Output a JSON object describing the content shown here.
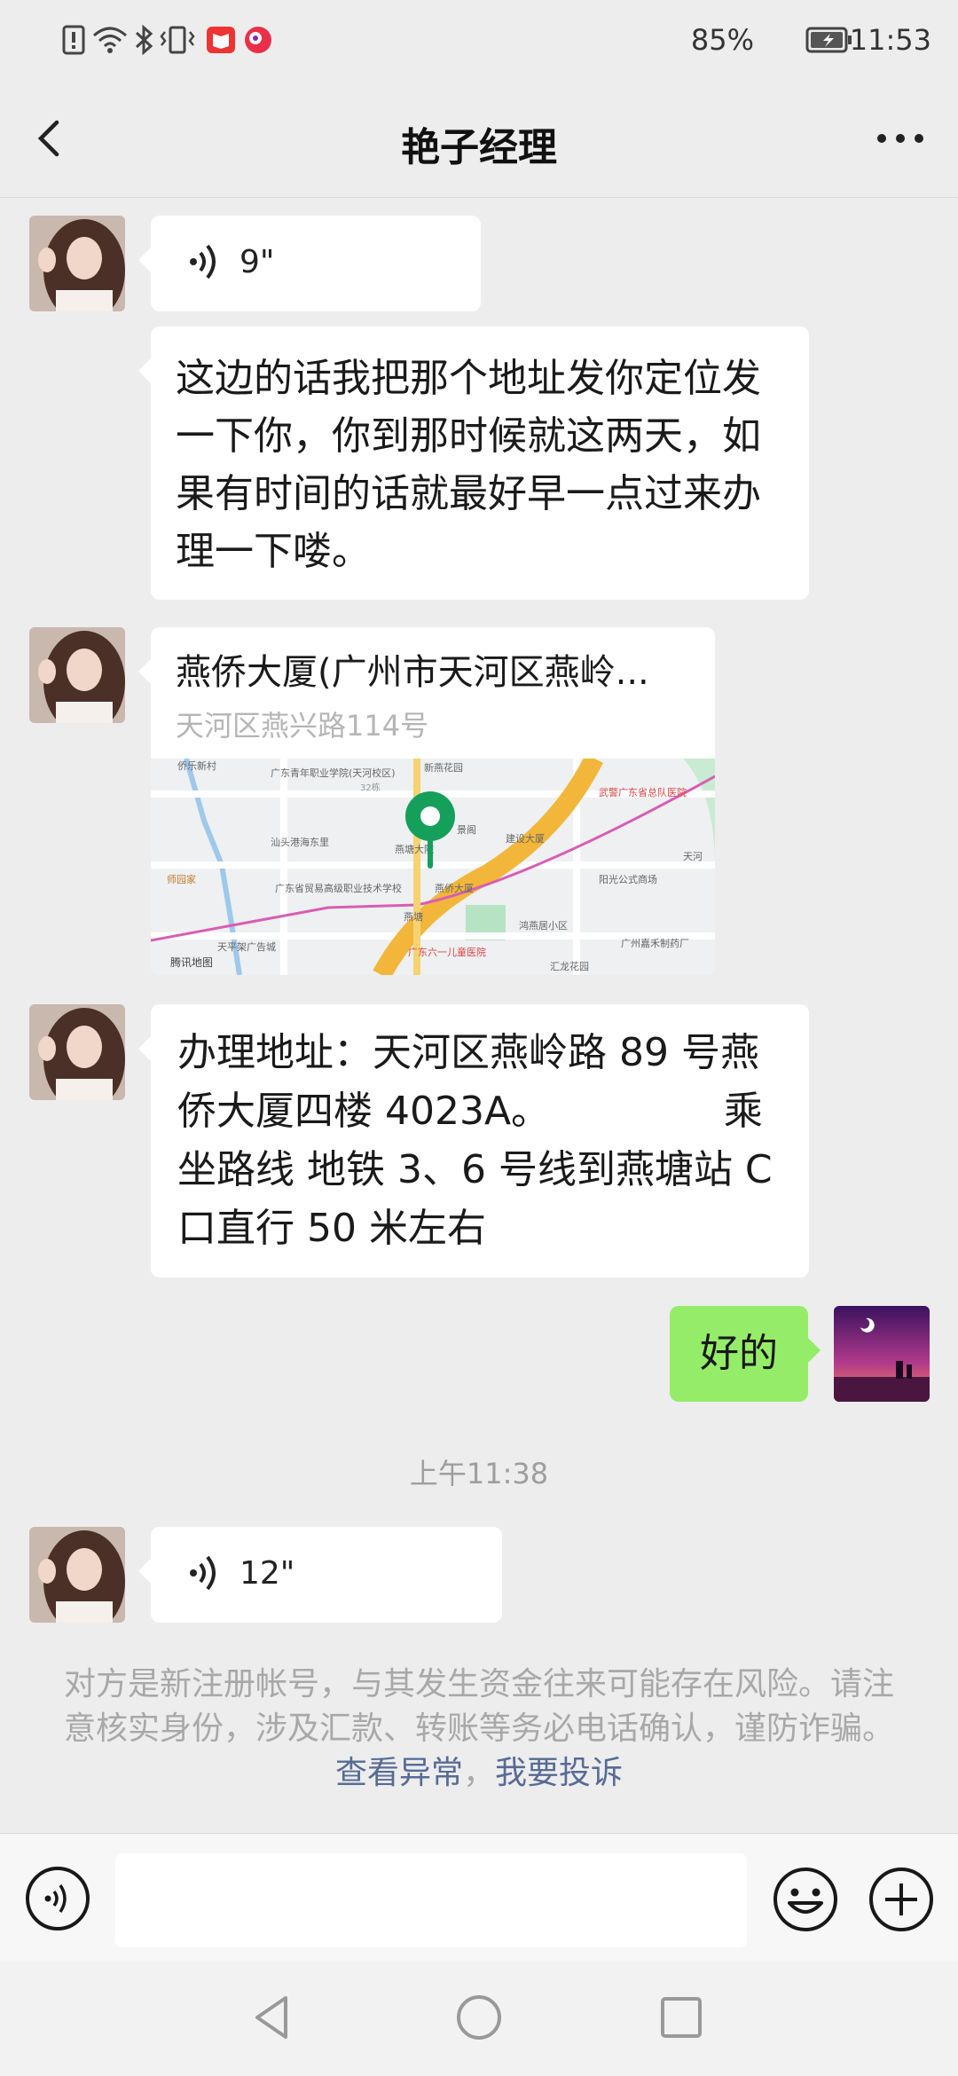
{
  "status_bar": {
    "battery_percent": "85%",
    "time": "11:53",
    "icons": [
      "alert-icon",
      "wifi-icon",
      "bluetooth-icon",
      "vibrate-icon",
      "app-notification-icon",
      "app-notification-icon-2",
      "battery-icon"
    ]
  },
  "header": {
    "title": "艳子经理",
    "back_icon": "chevron-left-icon",
    "more_icon": "more-dots-icon"
  },
  "messages": {
    "voice1_duration": "9\"",
    "text1": "这边的话我把那个地址发你定位发一下你，你到那时候就这两天，如果有时间的话就最好早一点过来办理一下喽。",
    "location": {
      "title": "燕侨大厦(广州市天河区燕岭...",
      "address": "天河区燕兴路114号",
      "map_labels": {
        "l1": "侨乐新村",
        "l2": "广东青年职业学院(天河校区)",
        "l3": "新燕花园",
        "l4": "武警广东省总队医院",
        "l5": "汕头港海东里",
        "l6": "景阁",
        "l7": "建设大厦",
        "l8": "燕塘大院",
        "l9": "天河",
        "l10": "师园家",
        "l11": "广东省贸易高级职业技术学校",
        "l12": "燕侨大厦",
        "l13": "阳光公式商场",
        "l14": "燕塘",
        "l15": "鸿燕居小区",
        "l16": "广州嘉禾制药厂",
        "l17": "天平架广告城",
        "l18": "广东六一儿童医院",
        "l19": "汇龙花园",
        "l20": "腾讯地图",
        "l21": "32栋"
      }
    },
    "text2": "办理地址：天河区燕岭路 89 号燕侨大厦四楼 4023A。              乘坐路线 地铁 3、6 号线到燕塘站 C 口直行 50 米左右",
    "my_reply": "好的",
    "time_separator": "上午11:38",
    "voice2_duration": "12\""
  },
  "warning": {
    "text": "对方是新注册帐号，与其发生资金往来可能存在风险。请注意核实身份，涉及汇款、转账等务必电话确认，谨防诈骗。",
    "link1": "查看异常",
    "separator": "，",
    "link2": "我要投诉"
  },
  "input_bar": {
    "placeholder": "",
    "voice_icon": "voice-mode-icon",
    "emoji_icon": "emoji-icon",
    "plus_icon": "plus-icon"
  },
  "nav_bar": {
    "back": "nav-back-icon",
    "home": "nav-home-icon",
    "recents": "nav-recents-icon"
  },
  "colors": {
    "background": "#ededed",
    "bubble_self": "#95ec69",
    "bubble_other": "#ffffff",
    "link": "#576b95",
    "map_pin": "#14a05a"
  }
}
